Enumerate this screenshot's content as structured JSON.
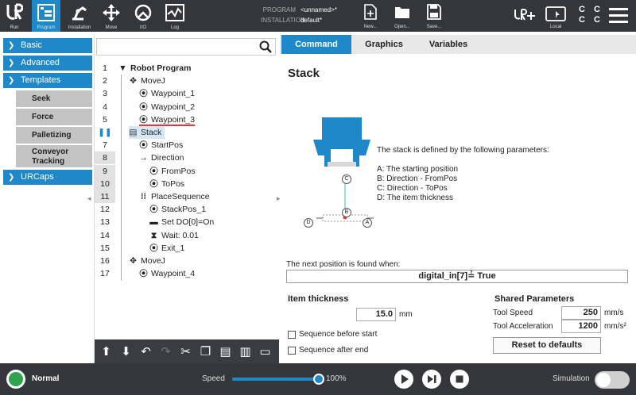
{
  "topnav": {
    "items": [
      {
        "label": "Run",
        "icon": "ur-logo-icon"
      },
      {
        "label": "Program",
        "icon": "program-icon"
      },
      {
        "label": "Installation",
        "icon": "installation-icon"
      },
      {
        "label": "Move",
        "icon": "move-icon"
      },
      {
        "label": "I/O",
        "icon": "io-icon"
      },
      {
        "label": "Log",
        "icon": "log-icon"
      }
    ],
    "program_key": "PROGRAM",
    "program_value": "<unnamed>*",
    "installation_key": "INSTALLATION",
    "installation_value": "default*",
    "tools": [
      {
        "label": "New...",
        "icon": "new-file-icon"
      },
      {
        "label": "Open...",
        "icon": "open-folder-icon"
      },
      {
        "label": "Save...",
        "icon": "save-icon"
      }
    ],
    "local_label": "Local",
    "cc": "C C\nC C"
  },
  "sidebar": {
    "basic": "Basic",
    "advanced": "Advanced",
    "templates": "Templates",
    "templates_items": [
      "Seek",
      "Force",
      "Palletizing",
      "Conveyor Tracking"
    ],
    "urcaps": "URCaps"
  },
  "tree": {
    "search_placeholder": "",
    "rows": [
      {
        "ln": "1",
        "text": "Robot Program",
        "indent": 0,
        "icon": "▼",
        "bold": true
      },
      {
        "ln": "2",
        "text": "MoveJ",
        "indent": 1,
        "icon": "✥",
        "bold": false
      },
      {
        "ln": "3",
        "text": "Waypoint_1",
        "indent": 2,
        "icon": "⦿",
        "bold": false
      },
      {
        "ln": "4",
        "text": "Waypoint_2",
        "indent": 2,
        "icon": "⦿",
        "bold": false
      },
      {
        "ln": "5",
        "text": "Waypoint_3",
        "indent": 2,
        "icon": "⦿",
        "bold": false
      },
      {
        "ln": "6",
        "text": "Stack",
        "indent": 1,
        "icon": "▤",
        "bold": false
      },
      {
        "ln": "7",
        "text": "StartPos",
        "indent": 2,
        "icon": "⦿",
        "bold": false
      },
      {
        "ln": "8",
        "text": "Direction",
        "indent": 2,
        "icon": "→",
        "bold": false
      },
      {
        "ln": "9",
        "text": "FromPos",
        "indent": 3,
        "icon": "⦿",
        "bold": false
      },
      {
        "ln": "10",
        "text": "ToPos",
        "indent": 3,
        "icon": "⦿",
        "bold": false
      },
      {
        "ln": "11",
        "text": "PlaceSequence",
        "indent": 2,
        "icon": "⁞⁞",
        "bold": false
      },
      {
        "ln": "12",
        "text": "StackPos_1",
        "indent": 3,
        "icon": "⦿",
        "bold": false
      },
      {
        "ln": "13",
        "text": "Set DO[0]=On",
        "indent": 3,
        "icon": "▬",
        "bold": false
      },
      {
        "ln": "14",
        "text": "Wait: 0.01",
        "indent": 3,
        "icon": "⧗",
        "bold": false
      },
      {
        "ln": "15",
        "text": "Exit_1",
        "indent": 3,
        "icon": "⦿",
        "bold": false
      },
      {
        "ln": "16",
        "text": "MoveJ",
        "indent": 1,
        "icon": "✥",
        "bold": false
      },
      {
        "ln": "17",
        "text": "Waypoint_4",
        "indent": 2,
        "icon": "⦿",
        "bold": false
      }
    ],
    "toolbar": [
      "🡅",
      "🡇",
      "↶",
      "↷",
      "✂",
      "❐",
      "📋",
      "🗑",
      "▭"
    ]
  },
  "right": {
    "tabs": [
      "Command",
      "Graphics",
      "Variables"
    ],
    "title": "Stack",
    "desc_intro": "The stack is defined by the following parameters:",
    "desc_a": "A: The starting position",
    "desc_b": "B: Direction - FromPos",
    "desc_c": "C: Direction - ToPos",
    "desc_d": "D: The item thickness",
    "diag_a": "A",
    "diag_b": "B",
    "diag_c": "C",
    "diag_d": "D",
    "next_label": "The next position is found when:",
    "expression": "digital_in[7]≟ True",
    "item_thickness_label": "Item thickness",
    "item_thickness_value": "15.0",
    "item_thickness_unit": "mm",
    "seq_before": "Sequence before start",
    "seq_after": "Sequence after end",
    "shared_label": "Shared Parameters",
    "tool_speed_label": "Tool Speed",
    "tool_speed_value": "250",
    "tool_speed_unit": "mm/s",
    "tool_accel_label": "Tool Acceleration",
    "tool_accel_value": "1200",
    "tool_accel_unit": "mm/s²",
    "reset_label": "Reset to defaults"
  },
  "footer": {
    "status": "Normal",
    "speed_label": "Speed",
    "speed_value": "100%",
    "speed_fraction": 1.0,
    "simulation_label": "Simulation"
  },
  "colors": {
    "accent": "#1f88c9",
    "dark": "#34363b",
    "status_ok": "#2ea44f"
  }
}
